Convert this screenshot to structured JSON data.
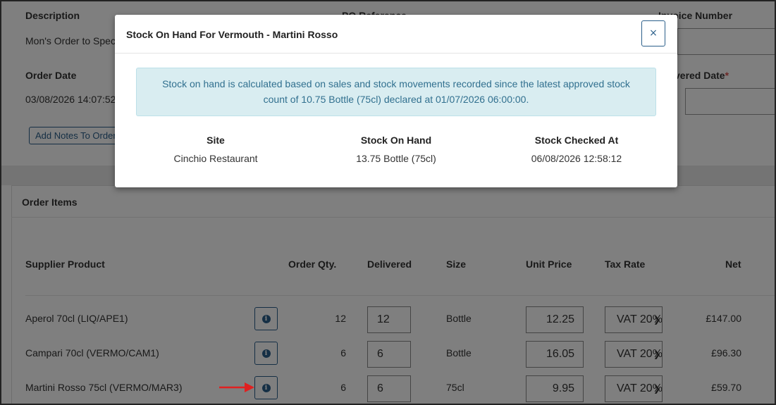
{
  "background": {
    "description_label": "Description",
    "description_value": "Mon's Order to Speci",
    "po_reference_label": "PO Reference",
    "invoice_number_label": "Invoice Number",
    "order_date_label": "Order Date",
    "order_date_value": "03/08/2026 14:07:52",
    "delivered_date_label": "vered Date",
    "required_marker": "*",
    "add_notes_label": "Add Notes To Order",
    "order_items_title": "Order Items",
    "table": {
      "headers": {
        "supplier_product": "Supplier Product",
        "order_qty": "Order Qty.",
        "delivered": "Delivered",
        "size": "Size",
        "unit_price": "Unit Price",
        "tax_rate": "Tax Rate",
        "net": "Net"
      },
      "rows": [
        {
          "product": "Aperol 70cl (LIQ/APE1)",
          "order_qty": "12",
          "delivered": "12",
          "size": "Bottle",
          "unit_price": "12.25",
          "tax_rate": "VAT 20%",
          "net": "£147.00"
        },
        {
          "product": "Campari 70cl (VERMO/CAM1)",
          "order_qty": "6",
          "delivered": "6",
          "size": "Bottle",
          "unit_price": "16.05",
          "tax_rate": "VAT 20%",
          "net": "£96.30"
        },
        {
          "product": "Martini Rosso 75cl (VERMO/MAR3)",
          "order_qty": "6",
          "delivered": "6",
          "size": "75cl",
          "unit_price": "9.95",
          "tax_rate": "VAT 20%",
          "net": "£59.70"
        }
      ]
    }
  },
  "modal": {
    "title": "Stock On Hand For Vermouth - Martini Rosso",
    "close_label": "×",
    "alert_line1": "Stock on hand is calculated based on sales and stock movements recorded since the latest approved stock",
    "alert_line2": "count of 10.75 Bottle (75cl) declared at 01/07/2026 06:00:00.",
    "headers": {
      "site": "Site",
      "stock_on_hand": "Stock On Hand",
      "stock_checked_at": "Stock Checked At"
    },
    "row": {
      "site": "Cinchio Restaurant",
      "stock_on_hand": "13.75 Bottle (75cl)",
      "stock_checked_at": "06/08/2026 12:58:12"
    }
  },
  "icons": {
    "info": "info-icon",
    "close": "close-icon",
    "chevron": "chevron-down-icon",
    "arrow": "arrow-right-icon"
  },
  "colors": {
    "accent": "#2b5f8a",
    "alert_bg": "#d9edf1",
    "alert_text": "#31708f",
    "arrow": "#e02020"
  }
}
